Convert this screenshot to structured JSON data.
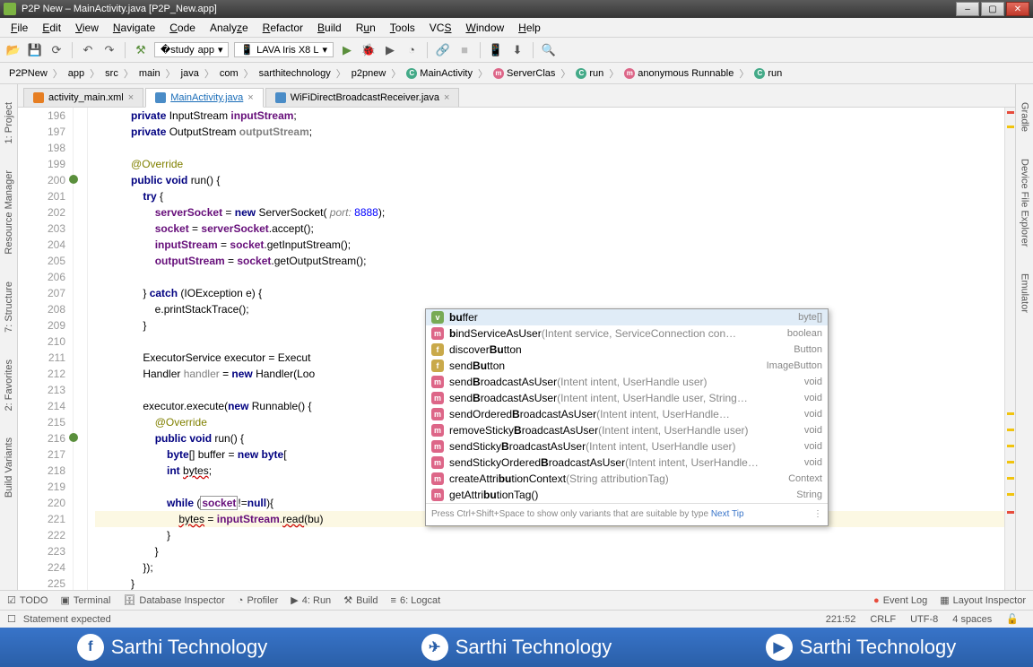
{
  "window": {
    "title": "P2P New – MainActivity.java [P2P_New.app]"
  },
  "menu": {
    "file": "File",
    "edit": "Edit",
    "view": "View",
    "navigate": "Navigate",
    "code": "Code",
    "analyze": "Analyze",
    "refactor": "Refactor",
    "build": "Build",
    "run": "Run",
    "tools": "Tools",
    "vcs": "VCS",
    "window": "Window",
    "help": "Help"
  },
  "toolbar": {
    "config": "app",
    "device": "LAVA Iris X8 L"
  },
  "breadcrumb": [
    "P2PNew",
    "app",
    "src",
    "main",
    "java",
    "com",
    "sarthitechnology",
    "p2pnew",
    "MainActivity",
    "ServerClas",
    "run",
    "anonymous Runnable",
    "run"
  ],
  "tabs": [
    {
      "name": "activity_main.xml",
      "type": "xml",
      "active": false
    },
    {
      "name": "MainActivity.java",
      "type": "java",
      "active": true
    },
    {
      "name": "WiFiDirectBroadcastReceiver.java",
      "type": "java",
      "active": false
    }
  ],
  "lines": {
    "start": 196,
    "end": 225
  },
  "code": {
    "196": [
      {
        "t": "private ",
        "c": "kw"
      },
      {
        "t": "InputStream "
      },
      {
        "t": "inputStream",
        "c": "fld"
      },
      {
        "t": ";"
      }
    ],
    "197": [
      {
        "t": "private ",
        "c": "kw"
      },
      {
        "t": "OutputStream "
      },
      {
        "t": "outputStream",
        "c": "fld unused"
      },
      {
        "t": ";"
      }
    ],
    "198": [],
    "199": [
      {
        "t": "@Override",
        "c": "ann"
      }
    ],
    "200": [
      {
        "t": "public void ",
        "c": "kw"
      },
      {
        "t": "run() {"
      }
    ],
    "201": [
      {
        "t": "try ",
        "c": "kw"
      },
      {
        "t": "{"
      }
    ],
    "202": [
      {
        "t": "serverSocket",
        "c": "fld"
      },
      {
        "t": " = "
      },
      {
        "t": "new ",
        "c": "kw"
      },
      {
        "t": "ServerSocket( "
      },
      {
        "t": "port: ",
        "c": "comm-param"
      },
      {
        "t": "8888",
        "c": "num"
      },
      {
        "t": ");"
      }
    ],
    "203": [
      {
        "t": "socket",
        "c": "fld"
      },
      {
        "t": " = "
      },
      {
        "t": "serverSocket",
        "c": "fld"
      },
      {
        "t": ".accept();"
      }
    ],
    "204": [
      {
        "t": "inputStream",
        "c": "fld"
      },
      {
        "t": " = "
      },
      {
        "t": "socket",
        "c": "fld"
      },
      {
        "t": ".getInputStream();"
      }
    ],
    "205": [
      {
        "t": "outputStream",
        "c": "fld"
      },
      {
        "t": " = "
      },
      {
        "t": "socket",
        "c": "fld"
      },
      {
        "t": ".getOutputStream();"
      }
    ],
    "206": [],
    "207": [
      {
        "t": "} "
      },
      {
        "t": "catch ",
        "c": "kw"
      },
      {
        "t": "(IOException e) {"
      }
    ],
    "208": [
      {
        "t": "e.printStackTrace();"
      }
    ],
    "209": [
      {
        "t": "}"
      }
    ],
    "210": [],
    "211": [
      {
        "t": "ExecutorService "
      },
      {
        "t": "executor"
      },
      {
        "t": " = Execut"
      }
    ],
    "212": [
      {
        "t": "Handler "
      },
      {
        "t": "handler",
        "c": "unused"
      },
      {
        "t": " = "
      },
      {
        "t": "new ",
        "c": "kw"
      },
      {
        "t": "Handler(Loo"
      }
    ],
    "213": [],
    "214": [
      {
        "t": "executor"
      },
      {
        "t": ".execute("
      },
      {
        "t": "new ",
        "c": "kw"
      },
      {
        "t": "Runnable() {"
      }
    ],
    "215": [
      {
        "t": "@Override",
        "c": "ann"
      }
    ],
    "216": [
      {
        "t": "public void ",
        "c": "kw"
      },
      {
        "t": "run() {"
      }
    ],
    "217": [
      {
        "t": "byte",
        "c": "kw"
      },
      {
        "t": "[] buffer = "
      },
      {
        "t": "new byte",
        "c": "kw"
      },
      {
        "t": "["
      }
    ],
    "218": [
      {
        "t": "int ",
        "c": "kw"
      },
      {
        "t": "bytes",
        "c": "underwave"
      },
      {
        "t": ";"
      }
    ],
    "219": [],
    "220": [
      {
        "t": "while ",
        "c": "kw"
      },
      {
        "t": "("
      },
      {
        "t": "socket",
        "c": "fld boxed"
      },
      {
        "t": "!="
      },
      {
        "t": "null",
        "c": "kw"
      },
      {
        "t": "){"
      }
    ],
    "221": [
      {
        "t": "bytes",
        "c": "underwave"
      },
      {
        "t": " = "
      },
      {
        "t": "inputStream",
        "c": "fld"
      },
      {
        "t": "."
      },
      {
        "t": "read",
        "c": "underwave"
      },
      {
        "t": "(bu)"
      }
    ],
    "222": [
      {
        "t": "}"
      }
    ],
    "223": [
      {
        "t": "}"
      }
    ],
    "224": [
      {
        "t": "});"
      }
    ],
    "225": [
      {
        "t": "}"
      }
    ]
  },
  "indent": {
    "196": 3,
    "197": 3,
    "198": 0,
    "199": 3,
    "200": 3,
    "201": 4,
    "202": 5,
    "203": 5,
    "204": 5,
    "205": 5,
    "206": 0,
    "207": 4,
    "208": 5,
    "209": 4,
    "210": 0,
    "211": 4,
    "212": 4,
    "213": 0,
    "214": 4,
    "215": 5,
    "216": 5,
    "217": 6,
    "218": 6,
    "219": 0,
    "220": 6,
    "221": 7,
    "222": 6,
    "223": 5,
    "224": 4,
    "225": 3
  },
  "completion": {
    "items": [
      {
        "icon": "v",
        "name": "buffer",
        "match": "bu",
        "type": "byte[]",
        "sel": true
      },
      {
        "icon": "m",
        "name": "bindServiceAsUser",
        "match": "b",
        "sig": "(Intent service, ServiceConnection con…",
        "type": "boolean"
      },
      {
        "icon": "f",
        "name": "discoverButton",
        "match": "Bu",
        "type": "Button"
      },
      {
        "icon": "f",
        "name": "sendButton",
        "match": "Bu",
        "type": "ImageButton"
      },
      {
        "icon": "m",
        "name": "sendBroadcastAsUser",
        "match": "B",
        "sig": "(Intent intent, UserHandle user)",
        "type": "void"
      },
      {
        "icon": "m",
        "name": "sendBroadcastAsUser",
        "match": "B",
        "sig": "(Intent intent, UserHandle user, String…",
        "type": "void"
      },
      {
        "icon": "m",
        "name": "sendOrderedBroadcastAsUser",
        "match": "B",
        "sig": "(Intent intent, UserHandle…",
        "type": "void"
      },
      {
        "icon": "m",
        "name": "removeStickyBroadcastAsUser",
        "match": "B",
        "sig": "(Intent intent, UserHandle user)",
        "type": "void",
        "strike": true
      },
      {
        "icon": "m",
        "name": "sendStickyBroadcastAsUser",
        "match": "B",
        "sig": "(Intent intent, UserHandle user)",
        "type": "void",
        "strike": true
      },
      {
        "icon": "m",
        "name": "sendStickyOrderedBroadcastAsUser",
        "match": "B",
        "sig": "(Intent intent, UserHandle…",
        "type": "void",
        "strike": true
      },
      {
        "icon": "m",
        "name": "createAttributionContext",
        "match": "bu",
        "sig": "(String attributionTag)",
        "type": "Context"
      },
      {
        "icon": "m",
        "name": "getAttributionTag()",
        "match": "bu",
        "type": "String",
        "faded": true
      }
    ],
    "tip": "Press Ctrl+Shift+Space to show only variants that are suitable by type",
    "tip_link": "Next Tip"
  },
  "bottom": {
    "todo": "TODO",
    "terminal": "Terminal",
    "db": "Database Inspector",
    "profiler": "Profiler",
    "run": "4: Run",
    "build": "Build",
    "logcat": "6: Logcat",
    "eventlog": "Event Log",
    "layout": "Layout Inspector"
  },
  "status": {
    "msg": "Statement expected",
    "pos": "221:52",
    "eol": "CRLF",
    "enc": "UTF-8",
    "indent": "4 spaces"
  },
  "left_tools": [
    "1: Project",
    "Resource Manager",
    "7: Structure",
    "2: Favorites",
    "Build Variants"
  ],
  "right_tools": [
    "Gradle",
    "Device File Explorer",
    "Emulator"
  ],
  "footer": "Sarthi Technology"
}
